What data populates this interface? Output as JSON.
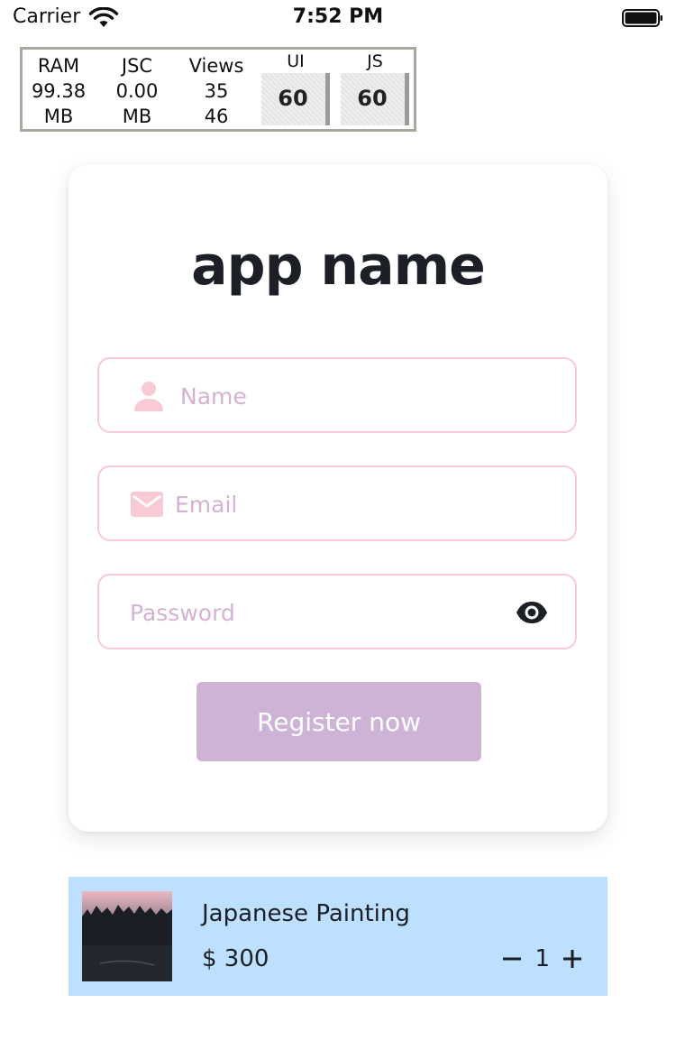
{
  "status_bar": {
    "carrier": "Carrier",
    "time": "7:52 PM"
  },
  "perf_monitor": {
    "ram_label": "RAM",
    "ram_value": "99.38",
    "ram_unit": "MB",
    "jsc_label": "JSC",
    "jsc_value": "0.00",
    "jsc_unit": "MB",
    "views_label": "Views",
    "views_value_1": "35",
    "views_value_2": "46",
    "ui_label": "UI",
    "ui_fps": "60",
    "js_label": "JS",
    "js_fps": "60"
  },
  "form": {
    "title": "app name",
    "name_placeholder": "Name",
    "email_placeholder": "Email",
    "password_placeholder": "Password",
    "register_label": "Register now"
  },
  "cart_item": {
    "name": "Japanese Painting",
    "price": "$ 300",
    "quantity": "1"
  },
  "colors": {
    "field_border": "#f9c9d6",
    "placeholder": "#d3b2d2",
    "icon_pink": "#f9c9d6",
    "button_bg": "#cdb3d6",
    "cart_bg": "#bde0fe",
    "title_text": "#1c1f26"
  },
  "icons": {
    "wifi": "wifi-icon",
    "battery": "battery-icon",
    "name_field": "user-icon",
    "email_field": "mail-icon",
    "password_toggle": "eye-icon",
    "decrement": "minus-icon",
    "increment": "plus-icon"
  }
}
